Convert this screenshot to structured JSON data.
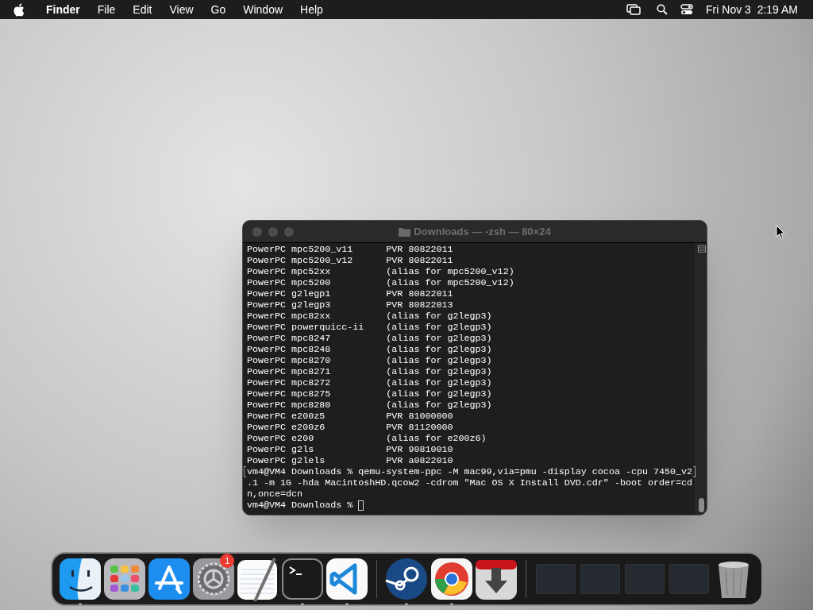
{
  "menu_bar": {
    "items": [
      "Finder",
      "File",
      "Edit",
      "View",
      "Go",
      "Window",
      "Help"
    ],
    "clock": "Fri Nov 3  2:19 AM"
  },
  "terminal": {
    "title": "Downloads — -zsh — 80×24",
    "active": false,
    "lines": [
      {
        "text": "PowerPC mpc5200_v11      PVR 80822011"
      },
      {
        "text": "PowerPC mpc5200_v12      PVR 80822011"
      },
      {
        "text": "PowerPC mpc52xx          (alias for mpc5200_v12)"
      },
      {
        "text": "PowerPC mpc5200          (alias for mpc5200_v12)"
      },
      {
        "text": "PowerPC g2legp1          PVR 80822011"
      },
      {
        "text": "PowerPC g2legp3          PVR 80822013"
      },
      {
        "text": "PowerPC mpc82xx          (alias for g2legp3)"
      },
      {
        "text": "PowerPC powerquicc-ii    (alias for g2legp3)"
      },
      {
        "text": "PowerPC mpc8247          (alias for g2legp3)"
      },
      {
        "text": "PowerPC mpc8248          (alias for g2legp3)"
      },
      {
        "text": "PowerPC mpc8270          (alias for g2legp3)"
      },
      {
        "text": "PowerPC mpc8271          (alias for g2legp3)"
      },
      {
        "text": "PowerPC mpc8272          (alias for g2legp3)"
      },
      {
        "text": "PowerPC mpc8275          (alias for g2legp3)"
      },
      {
        "text": "PowerPC mpc8280          (alias for g2legp3)"
      },
      {
        "text": "PowerPC e200z5           PVR 81000000"
      },
      {
        "text": "PowerPC e200z6           PVR 81120000"
      },
      {
        "text": "PowerPC e200             (alias for e200z6)"
      },
      {
        "text": "PowerPC g2ls             PVR 90810010"
      },
      {
        "text": "PowerPC g2lels           PVR a0822010"
      },
      {
        "text": "vm4@VM4 Downloads % qemu-system-ppc -M mac99,via=pmu -display cocoa -cpu 7450_v2",
        "marked": true
      },
      {
        "text": ".1 -m 1G -hda MacintoshHD.qcow2 -cdrom \"Mac OS X Install DVD.cdr\" -boot order=cd"
      },
      {
        "text": "n,once=dcn"
      },
      {
        "text": "vm4@VM4 Downloads % ",
        "cursor": true
      }
    ]
  },
  "dock": {
    "items": [
      {
        "kind": "app",
        "running": true
      },
      {
        "kind": "app",
        "running": false
      },
      {
        "kind": "app",
        "running": false
      },
      {
        "kind": "app",
        "running": false,
        "badge": "1"
      },
      {
        "kind": "app",
        "running": false
      },
      {
        "kind": "app",
        "running": true
      },
      {
        "kind": "app",
        "running": true
      },
      {
        "kind": "separator"
      },
      {
        "kind": "app",
        "running": true
      },
      {
        "kind": "app",
        "running": true
      },
      {
        "kind": "app",
        "running": false
      },
      {
        "kind": "separator"
      },
      {
        "kind": "window"
      },
      {
        "kind": "window"
      },
      {
        "kind": "window"
      },
      {
        "kind": "window"
      },
      {
        "kind": "trash"
      }
    ]
  }
}
